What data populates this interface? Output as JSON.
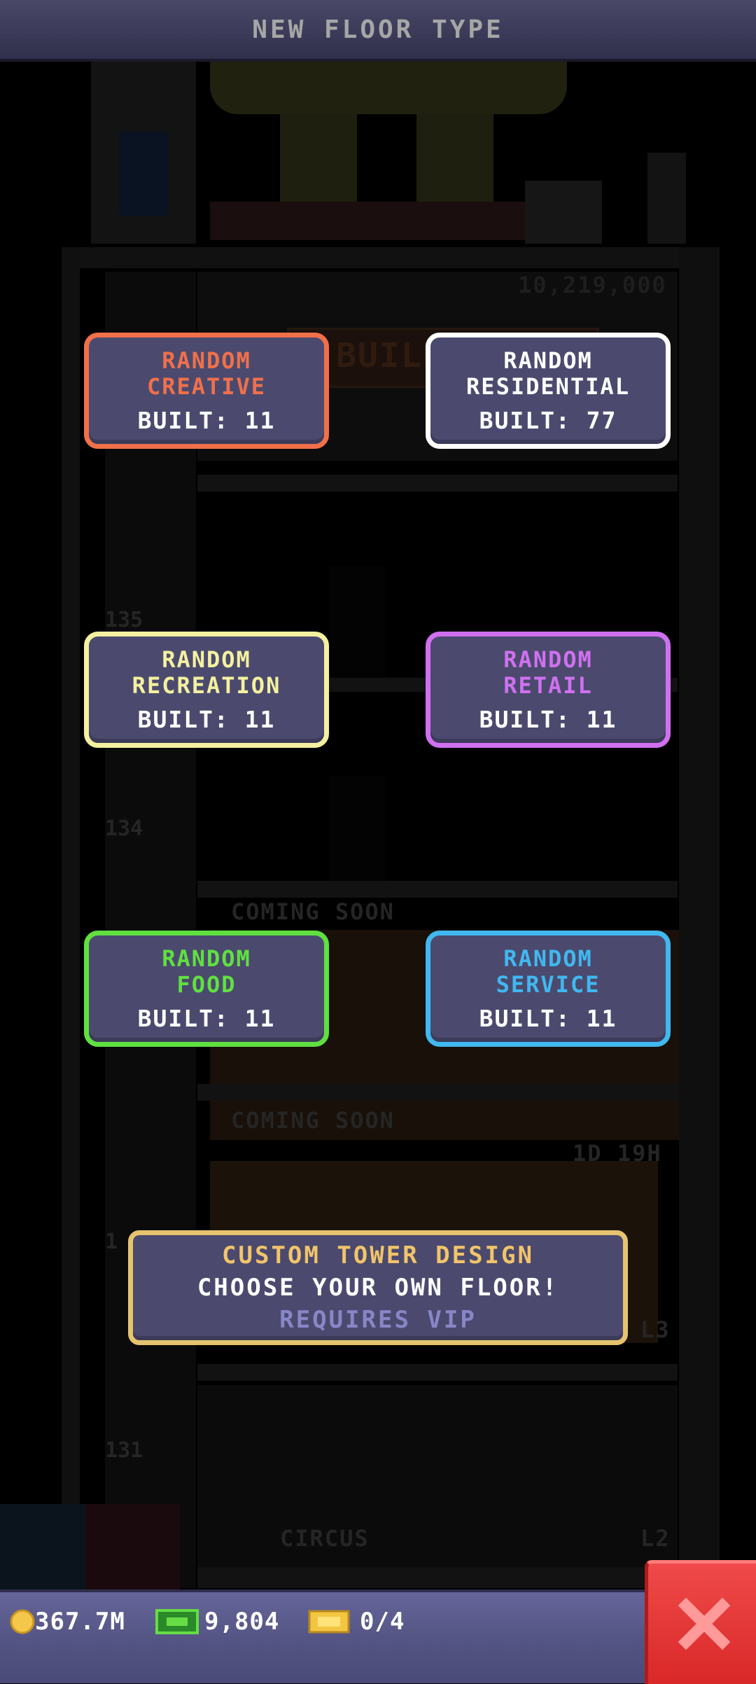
{
  "header": {
    "title": "NEW FLOOR TYPE"
  },
  "background": {
    "floor_numbers": [
      "135",
      "134",
      "1",
      "131"
    ],
    "price_label": "10,219,000",
    "build_sign": "BUILD",
    "coming_soon_1": "COMING SOON",
    "coming_soon_2": "COMING SOON",
    "timer": "1D 19H",
    "level_l3": "L3",
    "level_l2": "L2",
    "circus_label": "CIRCUS"
  },
  "floor_types": [
    {
      "name_line1": "RANDOM",
      "name_line2": "CREATIVE",
      "built": "BUILT: 11",
      "color": "#f0704a"
    },
    {
      "name_line1": "RANDOM",
      "name_line2": "RESIDENTIAL",
      "built": "BUILT: 77",
      "color": "#ffffff"
    },
    {
      "name_line1": "RANDOM",
      "name_line2": "RECREATION",
      "built": "BUILT: 11",
      "color": "#f4f0a0"
    },
    {
      "name_line1": "RANDOM",
      "name_line2": "RETAIL",
      "built": "BUILT: 11",
      "color": "#d070f0"
    },
    {
      "name_line1": "RANDOM",
      "name_line2": "FOOD",
      "built": "BUILT: 11",
      "color": "#60e040"
    },
    {
      "name_line1": "RANDOM",
      "name_line2": "SERVICE",
      "built": "BUILT: 11",
      "color": "#40b8f0"
    }
  ],
  "custom_design": {
    "title": "CUSTOM TOWER DESIGN",
    "subtitle": "CHOOSE YOUR OWN FLOOR!",
    "requirement": "REQUIRES VIP"
  },
  "bottom_bar": {
    "coins": "367.7M",
    "bux": "9,804",
    "tickets": "0/4"
  },
  "icons": {
    "close": "close-x-icon",
    "coin": "coin-icon",
    "bux": "tower-bux-icon",
    "ticket": "golden-ticket-icon"
  }
}
